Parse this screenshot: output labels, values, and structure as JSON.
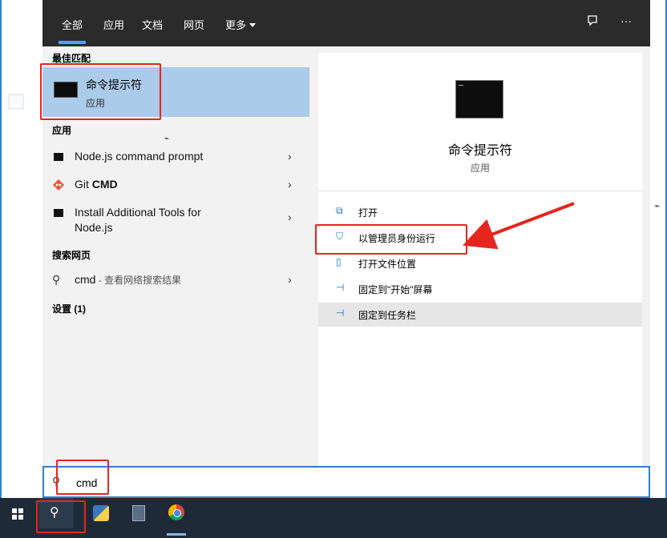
{
  "tabs": [
    "全部",
    "应用",
    "文档",
    "网页",
    "更多"
  ],
  "best_match": {
    "heading": "最佳匹配",
    "title": "命令提示符",
    "subtitle": "应用"
  },
  "apps": {
    "heading": "应用",
    "items": [
      {
        "label_a": "Node.js command prompt",
        "label_b": ""
      },
      {
        "label_a": "Git ",
        "label_b": "CMD"
      },
      {
        "label_a": "Install Additional Tools for",
        "label_b": "Node.js"
      }
    ]
  },
  "web": {
    "heading": "搜索网页",
    "query": "cmd",
    "hint": " - 查看网络搜索结果"
  },
  "settings": {
    "label": "设置 (1)"
  },
  "detail": {
    "title": "命令提示符",
    "subtitle": "应用",
    "actions": [
      "打开",
      "以管理员身份运行",
      "打开文件位置",
      "固定到\"开始\"屏幕",
      "固定到任务栏"
    ]
  },
  "search": {
    "value": "cmd"
  },
  "colors": {
    "accent": "#2f7fd6",
    "highlight": "#aacbea",
    "annotation": "#e4261f",
    "taskbar": "#1f2a38"
  },
  "icons": {
    "feedback": "feedback-icon",
    "more": "more-icon",
    "search": "search-icon",
    "windows": "windows-icon"
  }
}
